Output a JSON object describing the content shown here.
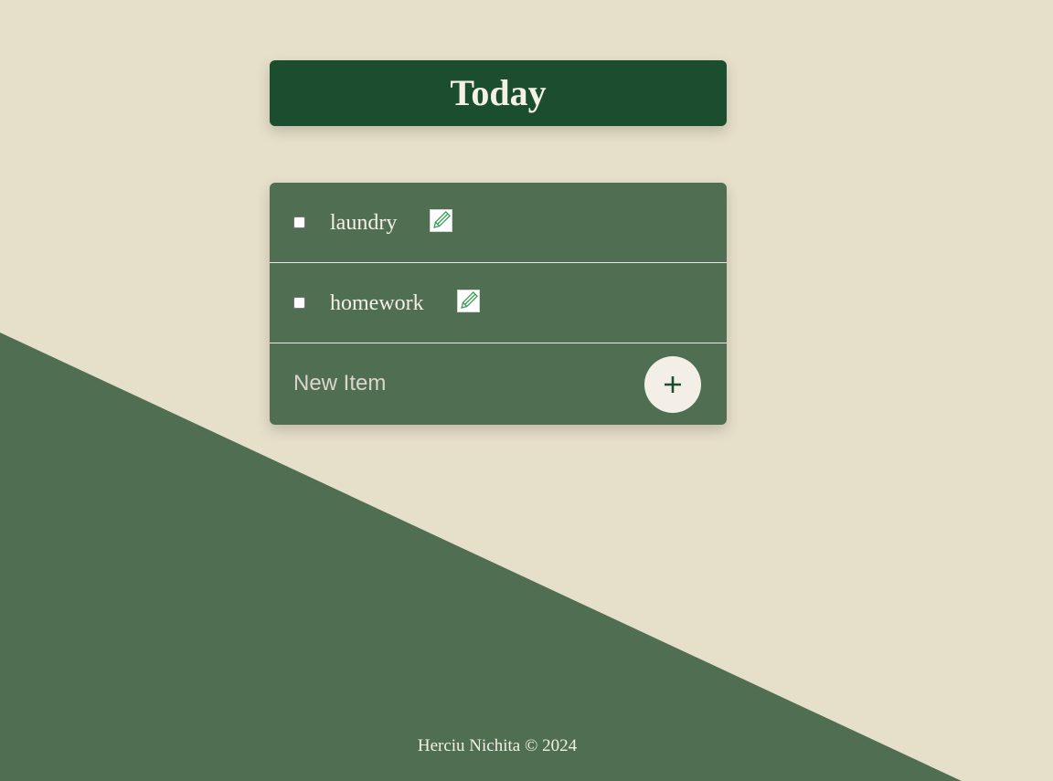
{
  "header": {
    "title": "Today"
  },
  "items": [
    {
      "label": "laundry",
      "checked": false,
      "edit_icon": "pencil-icon"
    },
    {
      "label": "homework",
      "checked": false,
      "edit_icon": "pencil-icon"
    }
  ],
  "new_item": {
    "placeholder": "New Item",
    "add_label": "+"
  },
  "footer": {
    "text": "Herciu Nichita © 2024"
  },
  "colors": {
    "background": "#e6dfca",
    "wedge": "#506f52",
    "title_bg": "#1b4d2f",
    "card_bg": "#506f52",
    "text_light": "#f4f0e6",
    "pencil": "#3a9a5a"
  }
}
